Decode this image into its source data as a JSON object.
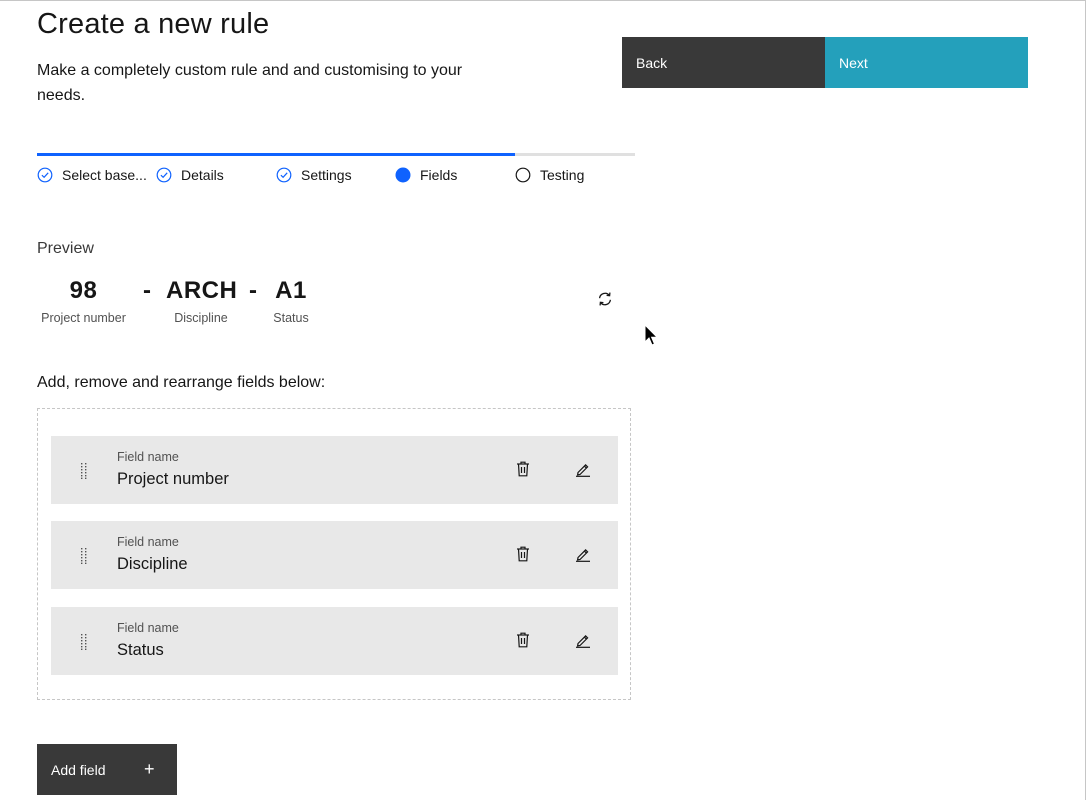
{
  "header": {
    "title": "Create a new rule",
    "description": "Make a completely custom rule and and customising to your needs."
  },
  "actions": {
    "back_label": "Back",
    "next_label": "Next"
  },
  "progress": {
    "completed_fraction": 0.8,
    "steps": [
      {
        "label": "Select base...",
        "state": "complete"
      },
      {
        "label": "Details",
        "state": "complete"
      },
      {
        "label": "Settings",
        "state": "complete"
      },
      {
        "label": "Fields",
        "state": "current"
      },
      {
        "label": "Testing",
        "state": "incomplete"
      }
    ]
  },
  "preview": {
    "label": "Preview",
    "separator": "-",
    "parts": [
      {
        "value": "98",
        "caption": "Project number"
      },
      {
        "value": "ARCH",
        "caption": "Discipline"
      },
      {
        "value": "A1",
        "caption": "Status"
      }
    ]
  },
  "fields": {
    "heading": "Add, remove and rearrange fields below:",
    "field_caption": "Field name",
    "items": [
      {
        "name": "Project number"
      },
      {
        "name": "Discipline"
      },
      {
        "name": "Status"
      }
    ],
    "add_label": "Add field",
    "add_symbol": "+"
  },
  "colors": {
    "accent": "#0f62fe",
    "next_button": "#24a0bb",
    "dark_button": "#393939",
    "field_background": "#e8e8e8"
  },
  "icons": {
    "complete": "checkmark-outline-icon",
    "current": "filled-circle-icon",
    "incomplete": "empty-circle-icon",
    "refresh": "refresh-icon",
    "drag": "drag-handle-icon",
    "delete": "trash-can-icon",
    "edit": "pencil-icon"
  }
}
